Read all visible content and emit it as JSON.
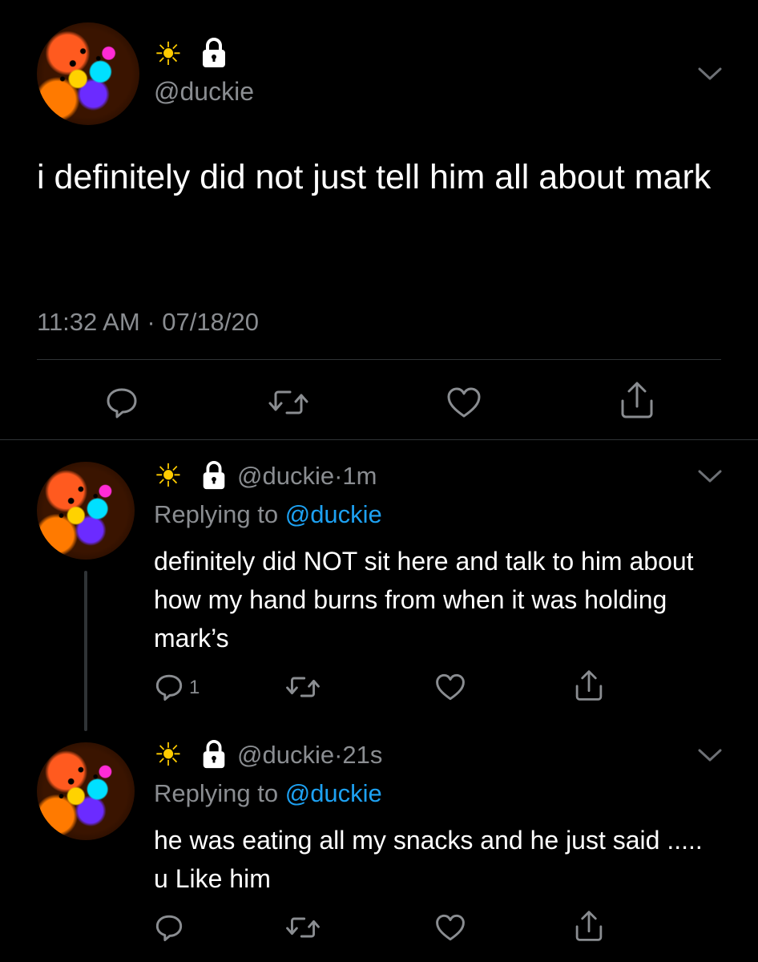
{
  "main_tweet": {
    "handle": "@duckie",
    "text": "i definitely did not just tell him all about mark",
    "time": "11:32 AM",
    "separator": "·",
    "date": "07/18/20",
    "icons": [
      "sun-emoji",
      "lock-icon",
      "chevron-down-icon",
      "reply-icon",
      "retweet-icon",
      "like-icon",
      "share-icon"
    ]
  },
  "replies": [
    {
      "handle": "@duckie",
      "dot": "·",
      "time_ago": "1m",
      "replying_prefix": "Replying to",
      "replying_to": "@duckie",
      "text": "definitely did NOT sit here and talk to him about how my hand burns from when it was holding mark’s",
      "reply_count": "1"
    },
    {
      "handle": "@duckie",
      "dot": "·",
      "time_ago": "21s",
      "replying_prefix": "Replying to",
      "replying_to": "@duckie",
      "text": "he was eating all my snacks and he just said ..... u Like him",
      "reply_count": ""
    }
  ],
  "colors": {
    "background": "#000000",
    "text": "#ffffff",
    "muted": "#8a8d91",
    "link": "#1da1f2",
    "divider": "#2f3336"
  }
}
